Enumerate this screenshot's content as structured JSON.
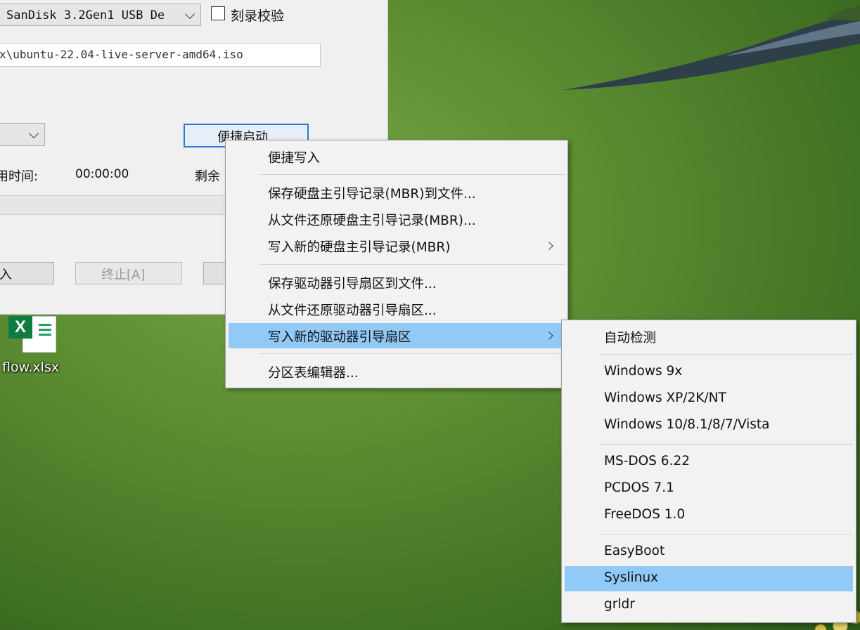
{
  "app": {
    "drive_select": "SanDisk 3.2Gen1 USB De",
    "verify_label": "刻录校验",
    "image_path": "x\\ubuntu-22.04-live-server-amd64.iso",
    "quick_boot_label": "便捷启动",
    "elapsed_label": "用时间:",
    "elapsed_value": "00:00:00",
    "remaining_label": "剩余",
    "write_button": "入",
    "abort_button": "终止[A]"
  },
  "desktop_icon": {
    "label": "flow.xlsx",
    "badge": "X"
  },
  "context_menu": {
    "items": [
      "便捷写入",
      "保存硬盘主引导记录(MBR)到文件...",
      "从文件还原硬盘主引导记录(MBR)...",
      "写入新的硬盘主引导记录(MBR)",
      "保存驱动器引导扇区到文件...",
      "从文件还原驱动器引导扇区...",
      "写入新的驱动器引导扇区",
      "分区表编辑器..."
    ]
  },
  "submenu": {
    "items": [
      "自动检测",
      "Windows 9x",
      "Windows XP/2K/NT",
      "Windows 10/8.1/8/7/Vista",
      "MS-DOS 6.22",
      "PCDOS 7.1",
      "FreeDOS 1.0",
      "EasyBoot",
      "Syslinux",
      "grldr"
    ]
  },
  "colors": {
    "highlight": "#91c9f7",
    "focus_border": "#2a7ad6",
    "excel_green": "#107c41"
  }
}
